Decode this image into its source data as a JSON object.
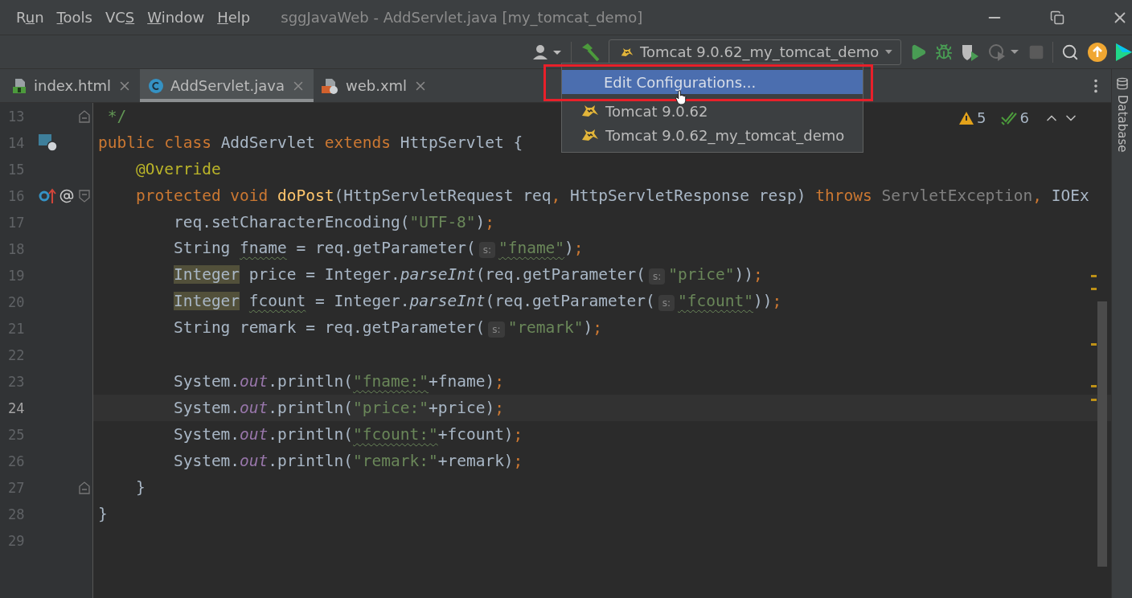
{
  "menu": [
    {
      "before": "R",
      "key": "u",
      "after": "n"
    },
    {
      "key": "T",
      "after": "ools"
    },
    {
      "before": "VC",
      "key": "S"
    },
    {
      "key": "W",
      "after": "indow"
    },
    {
      "key": "H",
      "after": "elp"
    }
  ],
  "window": {
    "title": "sggJavaWeb - AddServlet.java [my_tomcat_demo]"
  },
  "toolbar": {
    "run_config": "Tomcat 9.0.62_my_tomcat_demo"
  },
  "tabs": [
    {
      "label": "index.html",
      "kind": "html",
      "selected": false
    },
    {
      "label": "AddServlet.java",
      "kind": "java",
      "selected": true
    },
    {
      "label": "web.xml",
      "kind": "xml",
      "selected": false
    }
  ],
  "run_menu": {
    "items": [
      {
        "label": "Edit Configurations...",
        "kind": "action",
        "selected": true
      },
      {
        "label": "Tomcat 9.0.62",
        "kind": "config",
        "selected": false
      },
      {
        "label": "Tomcat 9.0.62_my_tomcat_demo",
        "kind": "config",
        "selected": false
      }
    ]
  },
  "inspections": {
    "warnings": "5",
    "weak_warnings": "6"
  },
  "editor": {
    "lines": [
      {
        "number": "13",
        "current": false,
        "fold": {
          "kind": "end"
        },
        "tokens": [
          {
            "kind": "comment",
            "text": " */"
          }
        ]
      },
      {
        "number": "14",
        "current": false,
        "gutter": [
          {
            "kind": "servlet"
          }
        ],
        "tokens": [
          {
            "kind": "keyword",
            "text": "public class "
          },
          {
            "kind": "plain",
            "text": "AddServlet "
          },
          {
            "kind": "keyword",
            "text": "extends "
          },
          {
            "kind": "plain",
            "text": "HttpServlet {"
          }
        ]
      },
      {
        "number": "15",
        "current": false,
        "tokens": [
          {
            "kind": "annotation",
            "text": "    @Override"
          }
        ]
      },
      {
        "number": "16",
        "current": false,
        "fold": {
          "kind": "start"
        },
        "gutter": [
          {
            "kind": "override"
          },
          {
            "kind": "annotation"
          }
        ],
        "tokens": [
          {
            "kind": "keyword",
            "text": "    protected void "
          },
          {
            "kind": "method",
            "text": "doPost"
          },
          {
            "kind": "plain",
            "text": "(HttpServletRequest req"
          },
          {
            "kind": "punct",
            "text": ", "
          },
          {
            "kind": "plain",
            "text": "HttpServletResponse resp) "
          },
          {
            "kind": "keyword",
            "text": "throws "
          },
          {
            "kind": "unused",
            "text": "ServletException"
          },
          {
            "kind": "punct",
            "text": ", "
          },
          {
            "kind": "plain",
            "text": "IOEx"
          }
        ]
      },
      {
        "number": "17",
        "current": false,
        "tokens": [
          {
            "kind": "plain",
            "text": "        req.setCharacterEncoding("
          },
          {
            "kind": "string",
            "text": "\"UTF-8\""
          },
          {
            "kind": "plain",
            "text": ")"
          },
          {
            "kind": "punct",
            "text": ";"
          }
        ]
      },
      {
        "number": "18",
        "current": false,
        "tokens": [
          {
            "kind": "plain",
            "text": "        String "
          },
          {
            "kind": "typo",
            "text": "fname"
          },
          {
            "kind": "plain",
            "text": " = req.getParameter("
          },
          {
            "kind": "hint",
            "text": "s:"
          },
          {
            "kind": "typostring",
            "text": "\"fname\""
          },
          {
            "kind": "plain",
            "text": ")"
          },
          {
            "kind": "punct",
            "text": ";"
          }
        ]
      },
      {
        "number": "19",
        "current": false,
        "tokens": [
          {
            "kind": "highlight",
            "text": "        Integer"
          },
          {
            "kind": "plain",
            "text": " price = Integer."
          },
          {
            "kind": "italic",
            "text": "parseInt"
          },
          {
            "kind": "plain",
            "text": "(req.getParameter("
          },
          {
            "kind": "hint",
            "text": "s:"
          },
          {
            "kind": "string",
            "text": "\"price\""
          },
          {
            "kind": "plain",
            "text": "))"
          },
          {
            "kind": "punct",
            "text": ";"
          }
        ]
      },
      {
        "number": "20",
        "current": false,
        "tokens": [
          {
            "kind": "highlight",
            "text": "        Integer"
          },
          {
            "kind": "typo",
            "text": " fcount"
          },
          {
            "kind": "plain",
            "text": " = Integer."
          },
          {
            "kind": "italic",
            "text": "parseInt"
          },
          {
            "kind": "plain",
            "text": "(req.getParameter("
          },
          {
            "kind": "hint",
            "text": "s:"
          },
          {
            "kind": "typostring",
            "text": "\"fcount\""
          },
          {
            "kind": "plain",
            "text": "))"
          },
          {
            "kind": "punct",
            "text": ";"
          }
        ]
      },
      {
        "number": "21",
        "current": false,
        "tokens": [
          {
            "kind": "plain",
            "text": "        String remark = req.getParameter("
          },
          {
            "kind": "hint",
            "text": "s:"
          },
          {
            "kind": "string",
            "text": "\"remark\""
          },
          {
            "kind": "plain",
            "text": ")"
          },
          {
            "kind": "punct",
            "text": ";"
          }
        ]
      },
      {
        "number": "22",
        "current": false
      },
      {
        "number": "23",
        "current": false,
        "tokens": [
          {
            "kind": "plain",
            "text": "        System."
          },
          {
            "kind": "static",
            "text": "out"
          },
          {
            "kind": "plain",
            "text": ".println("
          },
          {
            "kind": "typostring",
            "text": "\"fname:\""
          },
          {
            "kind": "plain",
            "text": "+fname)"
          },
          {
            "kind": "punct",
            "text": ";"
          }
        ]
      },
      {
        "number": "24",
        "current": true,
        "tokens": [
          {
            "kind": "plain",
            "text": "        System."
          },
          {
            "kind": "static",
            "text": "out"
          },
          {
            "kind": "plain",
            "text": ".println("
          },
          {
            "kind": "string",
            "text": "\"price:\""
          },
          {
            "kind": "plain",
            "text": "+price)"
          },
          {
            "kind": "punct",
            "text": ";"
          }
        ]
      },
      {
        "number": "25",
        "current": false,
        "tokens": [
          {
            "kind": "plain",
            "text": "        System."
          },
          {
            "kind": "static",
            "text": "out"
          },
          {
            "kind": "plain",
            "text": ".println("
          },
          {
            "kind": "typostring",
            "text": "\"fcount:\""
          },
          {
            "kind": "plain",
            "text": "+fcount)"
          },
          {
            "kind": "punct",
            "text": ";"
          }
        ]
      },
      {
        "number": "26",
        "current": false,
        "tokens": [
          {
            "kind": "plain",
            "text": "        System."
          },
          {
            "kind": "static",
            "text": "out"
          },
          {
            "kind": "plain",
            "text": ".println("
          },
          {
            "kind": "string",
            "text": "\"remark:\""
          },
          {
            "kind": "plain",
            "text": "+remark)"
          },
          {
            "kind": "punct",
            "text": ";"
          }
        ]
      },
      {
        "number": "27",
        "current": false,
        "fold": {
          "kind": "end"
        },
        "tokens": [
          {
            "kind": "plain",
            "text": "    }"
          }
        ]
      },
      {
        "number": "28",
        "current": false,
        "tokens": [
          {
            "kind": "plain",
            "text": "}"
          }
        ]
      },
      {
        "number": "29",
        "current": false
      }
    ]
  },
  "side_panel": {
    "label": "Database"
  }
}
